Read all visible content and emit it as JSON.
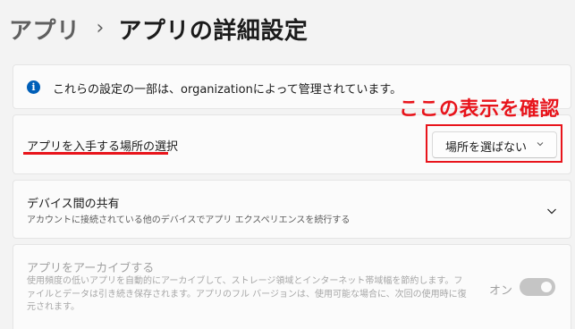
{
  "header": {
    "parent": "アプリ",
    "separator": "›",
    "current": "アプリの詳細設定"
  },
  "info": {
    "icon": "info-icon",
    "icon_glyph": "i",
    "text": "これらの設定の一部は、organizationによって管理されています。"
  },
  "annotation": {
    "label": "ここの表示を確認",
    "color": "#e8141b"
  },
  "install_source": {
    "label": "アプリを入手する場所の選択",
    "selected": "場所を選ばない",
    "chevron_icon": "chevron-down-icon"
  },
  "sharing": {
    "title": "デバイス間の共有",
    "description": "アカウントに接続されている他のデバイスでアプリ エクスペリエンスを続行する",
    "expand_icon": "chevron-down-icon"
  },
  "archive": {
    "title": "アプリをアーカイブする",
    "description": "使用頻度の低いアプリを自動的にアーカイブして、ストレージ領域とインターネット帯域幅を節約します。ファイルとデータは引き続き保存されます。アプリのフル バージョンは、使用可能な場合に、次回の使用時に復元されます。",
    "toggle_label": "オン",
    "toggle_on": true,
    "disabled": true
  },
  "colors": {
    "accent": "#005fb8",
    "annotation": "#e8141b",
    "background": "#f3f3f3",
    "card": "#fbfbfb"
  }
}
